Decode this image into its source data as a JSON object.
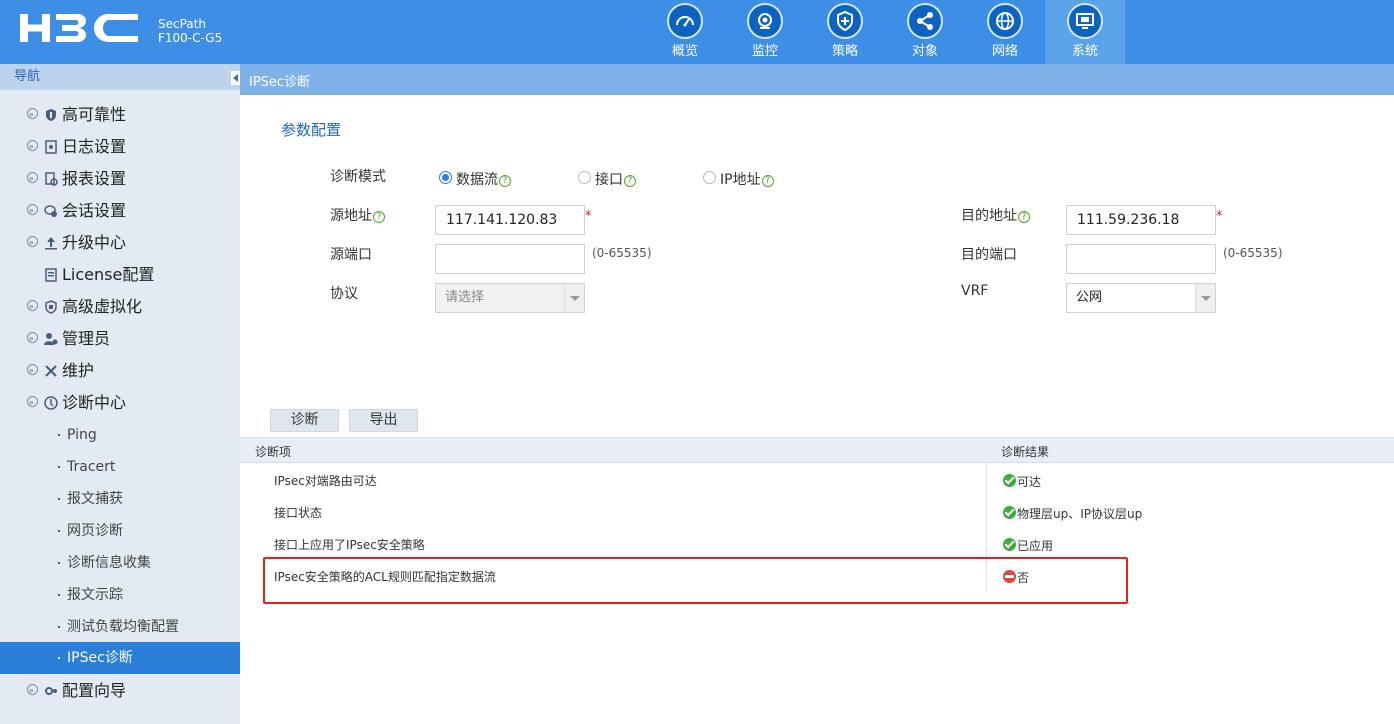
{
  "header": {
    "product_line1": "SecPath",
    "product_line2": "F100-C-G5",
    "nav": [
      {
        "label": "概览",
        "icon": "speedometer-icon"
      },
      {
        "label": "监控",
        "icon": "camera-icon"
      },
      {
        "label": "策略",
        "icon": "shield-icon"
      },
      {
        "label": "对象",
        "icon": "share-icon"
      },
      {
        "label": "网络",
        "icon": "globe-icon"
      },
      {
        "label": "系统",
        "icon": "monitor-icon",
        "active": true
      }
    ]
  },
  "sidebar": {
    "title": "导航",
    "items": [
      {
        "label": "高可靠性",
        "icon": "shield-icon"
      },
      {
        "label": "日志设置",
        "icon": "log-icon"
      },
      {
        "label": "报表设置",
        "icon": "report-icon"
      },
      {
        "label": "会话设置",
        "icon": "session-icon"
      },
      {
        "label": "升级中心",
        "icon": "upload-icon"
      },
      {
        "label": "License配置",
        "icon": "license-icon"
      },
      {
        "label": "高级虚拟化",
        "icon": "virtualization-icon"
      },
      {
        "label": "管理员",
        "icon": "admin-icon"
      },
      {
        "label": "维护",
        "icon": "tools-icon"
      },
      {
        "label": "诊断中心",
        "icon": "diagnosis-icon",
        "expanded": true
      }
    ],
    "subitems": [
      {
        "label": "Ping"
      },
      {
        "label": "Tracert"
      },
      {
        "label": "报文捕获"
      },
      {
        "label": "网页诊断"
      },
      {
        "label": "诊断信息收集"
      },
      {
        "label": "报文示踪"
      },
      {
        "label": "测试负载均衡配置"
      },
      {
        "label": "IPSec诊断",
        "active": true
      }
    ],
    "last_item": {
      "label": "配置向导",
      "icon": "wizard-icon"
    }
  },
  "breadcrumb": "IPSec诊断",
  "form": {
    "section_title": "参数配置",
    "mode_label": "诊断模式",
    "mode_options": [
      {
        "label": "数据流",
        "selected": true
      },
      {
        "label": "接口",
        "selected": false
      },
      {
        "label": "IP地址",
        "selected": false
      }
    ],
    "src_addr_label": "源地址",
    "src_addr_value": "117.141.120.83",
    "dst_addr_label": "目的地址",
    "dst_addr_value": "111.59.236.18",
    "src_port_label": "源端口",
    "src_port_value": "",
    "dst_port_label": "目的端口",
    "dst_port_value": "",
    "port_hint": "(0-65535)",
    "protocol_label": "协议",
    "protocol_value": "请选择",
    "vrf_label": "VRF",
    "vrf_value": "公网",
    "required_mark": "*"
  },
  "buttons": {
    "diagnose": "诊断",
    "export": "导出"
  },
  "table": {
    "col_item": "诊断项",
    "col_result": "诊断结果",
    "rows": [
      {
        "item": "IPsec对端路由可达",
        "result": "可达",
        "status": "ok"
      },
      {
        "item": "接口状态",
        "result": "物理层up、IP协议层up",
        "status": "ok"
      },
      {
        "item": "接口上应用了IPsec安全策略",
        "result": "已应用",
        "status": "ok"
      },
      {
        "item": "IPsec安全策略的ACL规则匹配指定数据流",
        "result": "否",
        "status": "fail"
      }
    ]
  },
  "colors": {
    "header_bg": "#3d8fe6",
    "accent": "#2b7fd8",
    "ok": "#3bab3b",
    "fail": "#e04444",
    "highlight": "#e8201e"
  }
}
